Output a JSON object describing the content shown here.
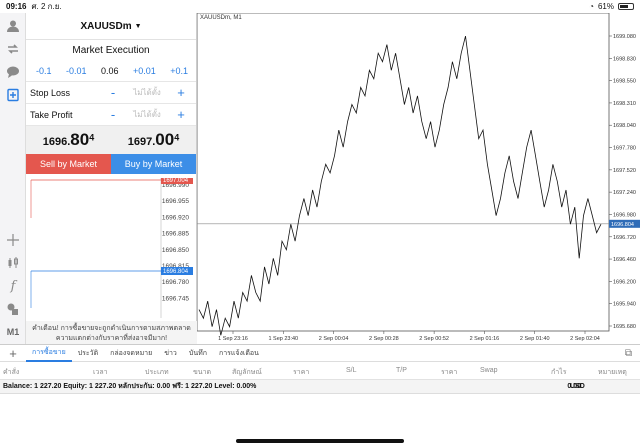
{
  "status": {
    "time": "09:16",
    "date": "ศ. 2 ก.ย.",
    "battery": "61%",
    "battery_level": 0.61
  },
  "rail": {
    "icons": [
      "person-icon",
      "exchange-icon",
      "chat-icon",
      "new-order-icon",
      "crosshair-icon",
      "candles-icon",
      "function-icon",
      "objects-icon"
    ],
    "timeframe": "M1"
  },
  "order": {
    "symbol": "XAUUSDm",
    "caret": "▼",
    "execution": "Market Execution",
    "volume_buttons": [
      "-0.1",
      "-0.01",
      "0.06",
      "+0.01",
      "+0.1"
    ],
    "stop_loss": {
      "label": "Stop Loss",
      "minus": "-",
      "placeholder": "ไม่ได้ตั้ง",
      "plus": "+"
    },
    "take_profit": {
      "label": "Take Profit",
      "minus": "-",
      "placeholder": "ไม่ได้ตั้ง",
      "plus": "+"
    },
    "bid": {
      "main": "1696.",
      "big": "80",
      "sup": "4"
    },
    "ask": {
      "main": "1697.",
      "big": "00",
      "sup": "4"
    },
    "sell_label": "Sell by Market",
    "buy_label": "Buy by Market",
    "mini_ticks": [
      "1696.990",
      "1696.955",
      "1696.920",
      "1696.885",
      "1696.850",
      "1696.815",
      "1696.780",
      "1696.745"
    ],
    "mini_ask_tag": "1697.004",
    "mini_bid_tag": "1696.804",
    "warning": "คำเตือน! การซื้อขายจะถูกดำเนินการตามสภาพตลาด ความแตกต่างกับราคาที่ส่งอาจมีมาก!"
  },
  "chart_data": {
    "type": "line",
    "title": "XAUUSDm, M1",
    "x_labels": [
      "1 Sep 23:16",
      "1 Sep 23:40",
      "2 Sep 00:04",
      "2 Sep 00:28",
      "2 Sep 00:52",
      "2 Sep 01:16",
      "2 Sep 01:40",
      "2 Sep 02:04"
    ],
    "y_ticks": [
      "1699.080",
      "1698.830",
      "1698.550",
      "1698.310",
      "1698.040",
      "1697.780",
      "1697.520",
      "1697.240",
      "1696.980",
      "1696.720",
      "1696.460",
      "1696.200",
      "1695.940",
      "1695.680"
    ],
    "ylim": [
      1695.55,
      1699.2
    ],
    "current_price": 1696.804,
    "current_label": "1696.804",
    "values": [
      1695.8,
      1695.7,
      1695.9,
      1695.6,
      1695.8,
      1695.5,
      1695.7,
      1695.6,
      1695.9,
      1695.7,
      1696.0,
      1695.9,
      1696.2,
      1696.0,
      1695.9,
      1696.3,
      1696.1,
      1696.4,
      1696.2,
      1696.6,
      1696.5,
      1696.8,
      1696.6,
      1696.9,
      1697.1,
      1696.9,
      1697.2,
      1697.0,
      1697.3,
      1697.5,
      1697.4,
      1697.6,
      1697.9,
      1697.7,
      1698.0,
      1698.2,
      1698.1,
      1698.4,
      1698.3,
      1698.6,
      1698.5,
      1698.8,
      1698.7,
      1698.9,
      1698.6,
      1698.8,
      1698.5,
      1698.2,
      1698.4,
      1698.1,
      1698.3,
      1698.0,
      1697.8,
      1698.0,
      1697.7,
      1697.9,
      1698.2,
      1698.4,
      1698.7,
      1698.5,
      1698.8,
      1699.0,
      1698.6,
      1698.2,
      1697.8,
      1697.9,
      1697.5,
      1697.2,
      1696.9,
      1697.1,
      1697.4,
      1697.6,
      1697.3,
      1697.1,
      1697.4,
      1697.7,
      1697.9,
      1697.6,
      1697.3,
      1697.0,
      1697.2,
      1697.5,
      1697.3,
      1697.0,
      1697.2,
      1696.8,
      1697.0,
      1696.4,
      1696.9,
      1697.1,
      1696.9,
      1696.7,
      1696.8
    ]
  },
  "tabs": {
    "plus": "+",
    "items": [
      "การซื้อขาย",
      "ประวัติ",
      "กล่องจดหมาย",
      "ข่าว",
      "บันทึก",
      "การแจ้งเตือน"
    ],
    "active": 0
  },
  "columns": [
    "คำสั่ง",
    "เวลา",
    "ประเภท",
    "ขนาด",
    "สัญลักษณ์",
    "ราคา",
    "S/L",
    "T/P",
    "ราคา",
    "Swap",
    "กำไร",
    "หมายเหตุ"
  ],
  "balance": {
    "text": "Balance: 1 227.20 Equity: 1 227.20 หลักประกัน: 0.00 ฟรี: 1 227.20 Level: 0.00%",
    "profit": "0.00",
    "currency": "USD"
  }
}
